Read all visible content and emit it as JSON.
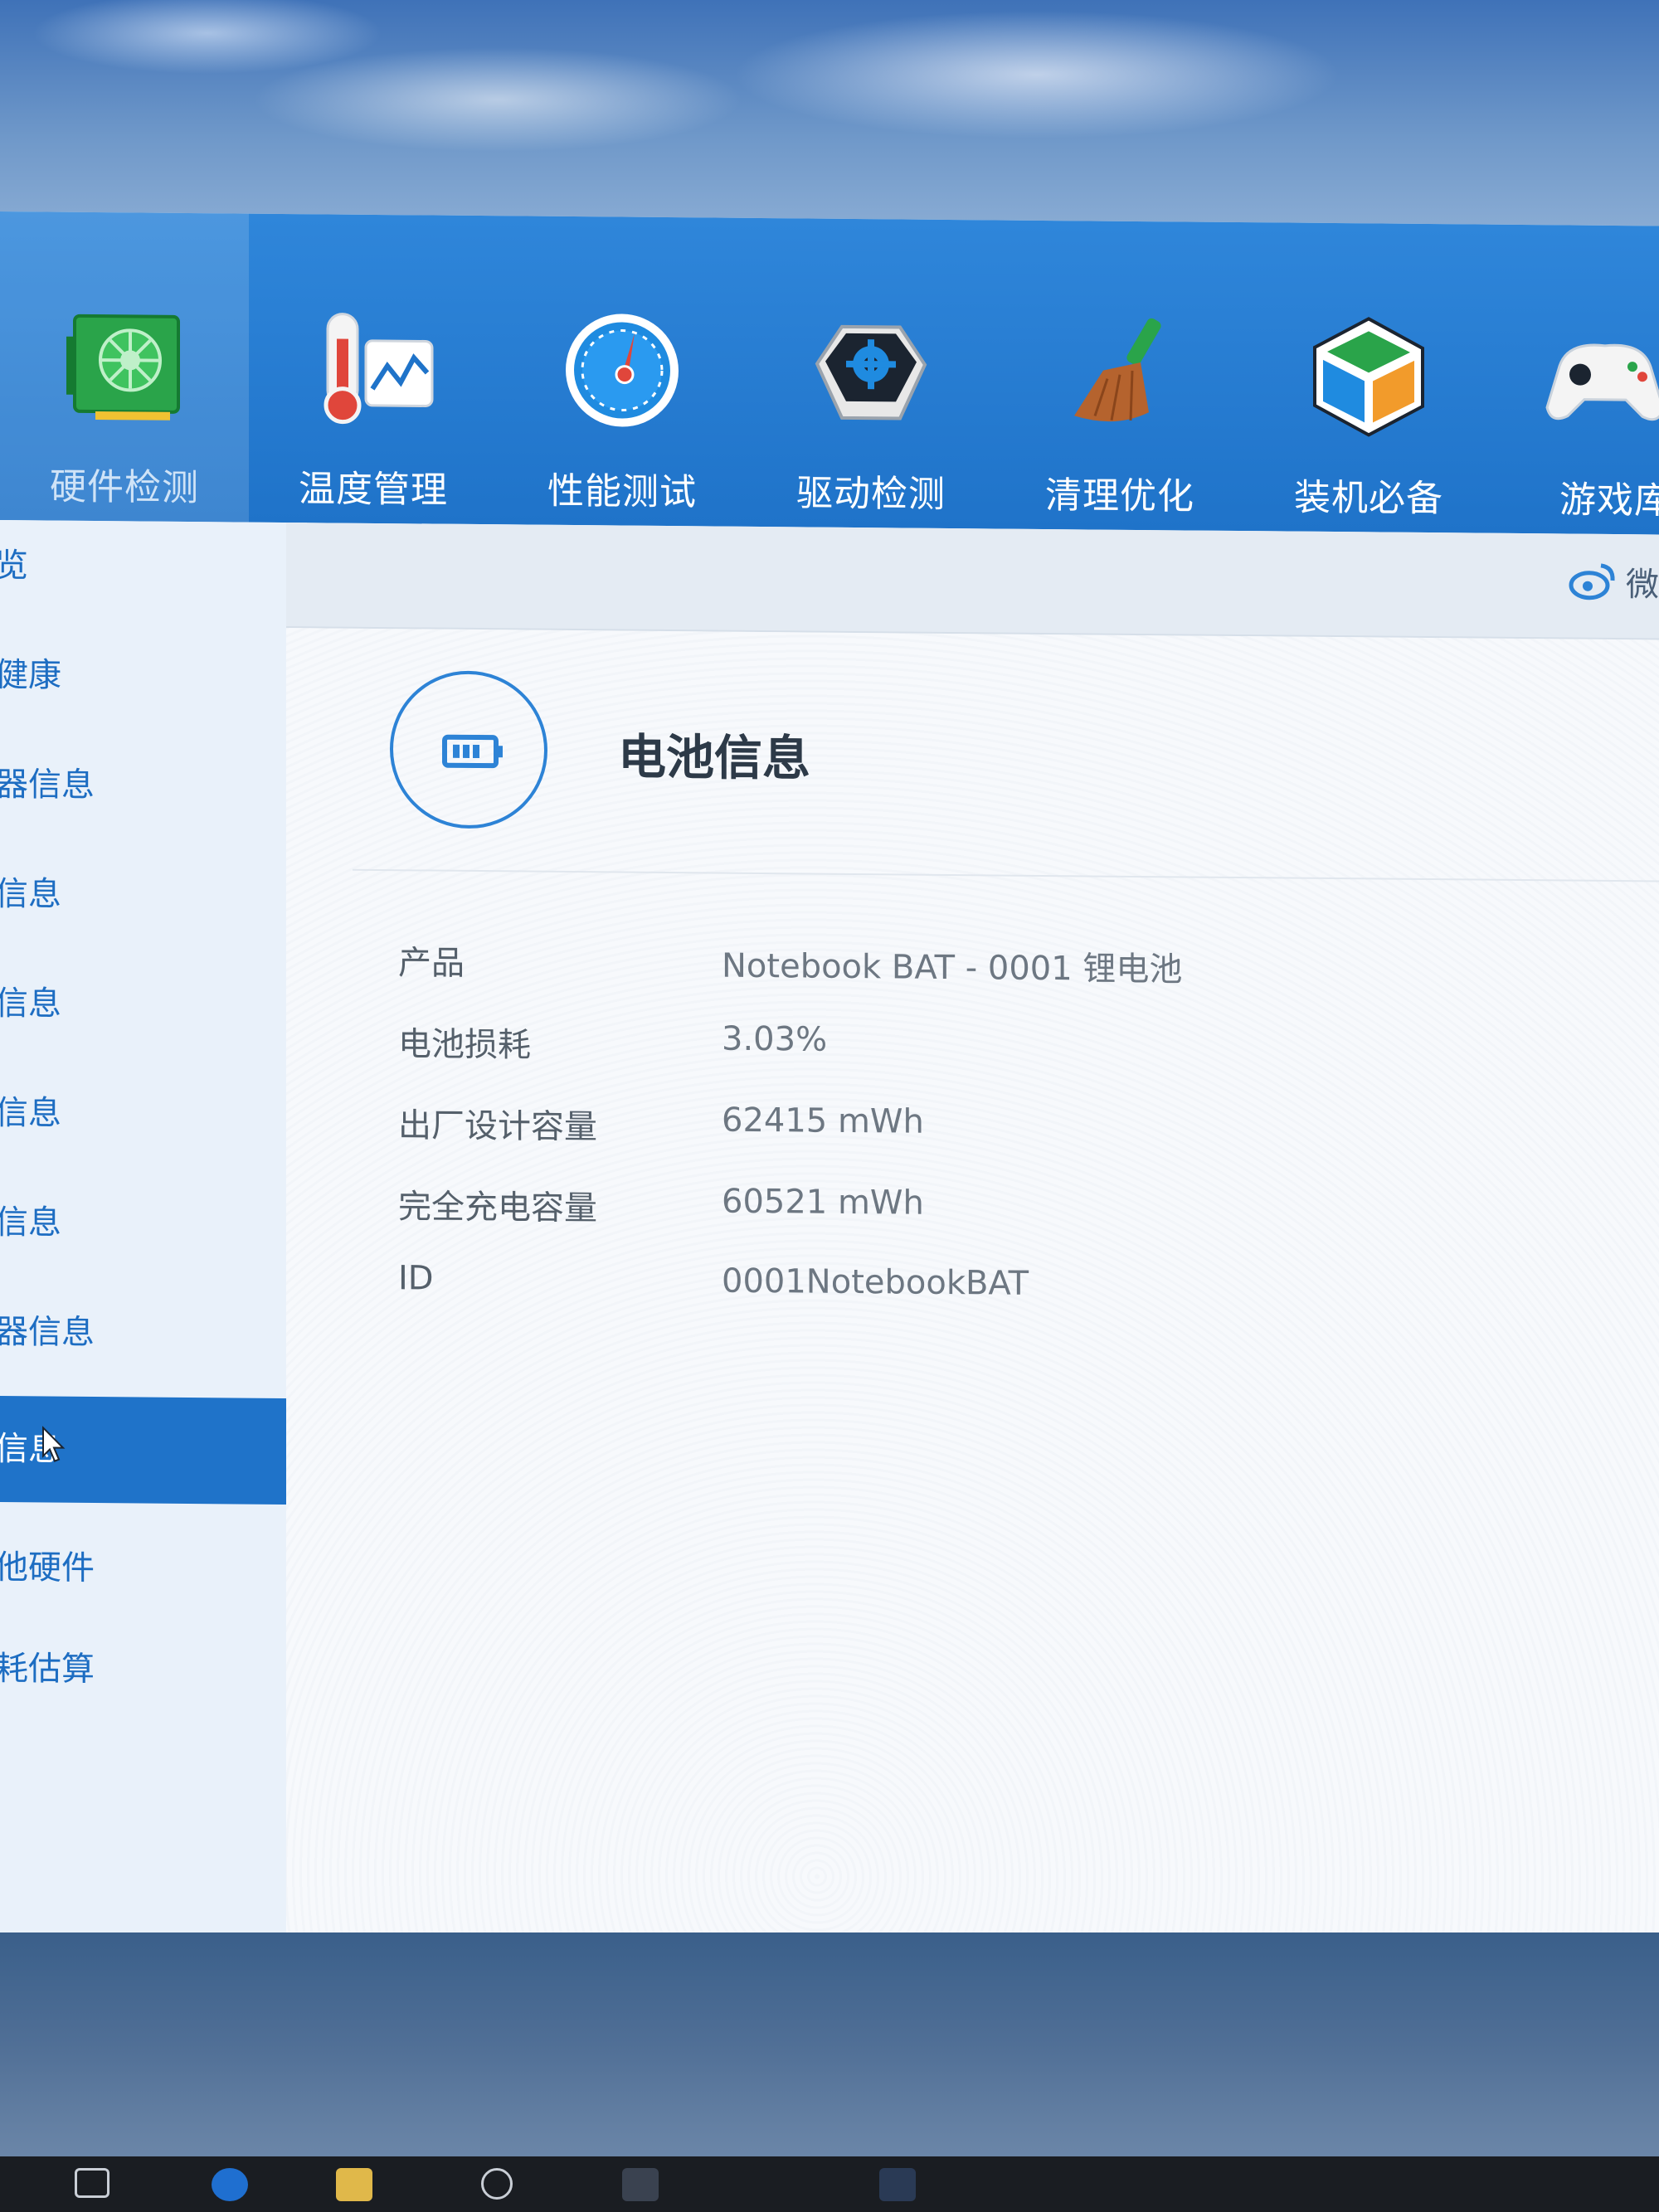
{
  "top_nav": {
    "items": [
      {
        "label": "硬件检测",
        "icon": "graphics-card-icon",
        "active": true
      },
      {
        "label": "温度管理",
        "icon": "thermometer-icon",
        "active": false
      },
      {
        "label": "性能测试",
        "icon": "speedometer-icon",
        "active": false
      },
      {
        "label": "驱动检测",
        "icon": "driver-gear-icon",
        "active": false
      },
      {
        "label": "清理优化",
        "icon": "broom-icon",
        "active": false
      },
      {
        "label": "装机必备",
        "icon": "cube-icon",
        "active": false
      },
      {
        "label": "游戏库",
        "icon": "gamepad-icon",
        "active": false
      }
    ]
  },
  "sidebar": {
    "items": [
      {
        "label": "览"
      },
      {
        "label": "健康"
      },
      {
        "label": "器信息"
      },
      {
        "label": "信息"
      },
      {
        "label": "信息"
      },
      {
        "label": "信息"
      },
      {
        "label": "信息"
      },
      {
        "label": "器信息"
      },
      {
        "label": "信息",
        "active": true
      },
      {
        "label": "他硬件"
      },
      {
        "label": "耗估算"
      }
    ]
  },
  "subheader": {
    "weibo_icon": "weibo-icon",
    "weibo_text": "微"
  },
  "content": {
    "title": "电池信息",
    "rows": [
      {
        "label": "产品",
        "value": "Notebook BAT - 0001 锂电池"
      },
      {
        "label": "电池损耗",
        "value": "3.03%"
      },
      {
        "label": "出厂设计容量",
        "value": "62415 mWh"
      },
      {
        "label": "完全充电容量",
        "value": "60521 mWh"
      },
      {
        "label": "ID",
        "value": "0001NotebookBAT"
      }
    ]
  },
  "colors": {
    "nav_blue": "#1f73c9",
    "sidebar_active": "#1f73c9",
    "sidebar_text": "#1d6dc2",
    "badge_blue": "#2d83d6"
  }
}
